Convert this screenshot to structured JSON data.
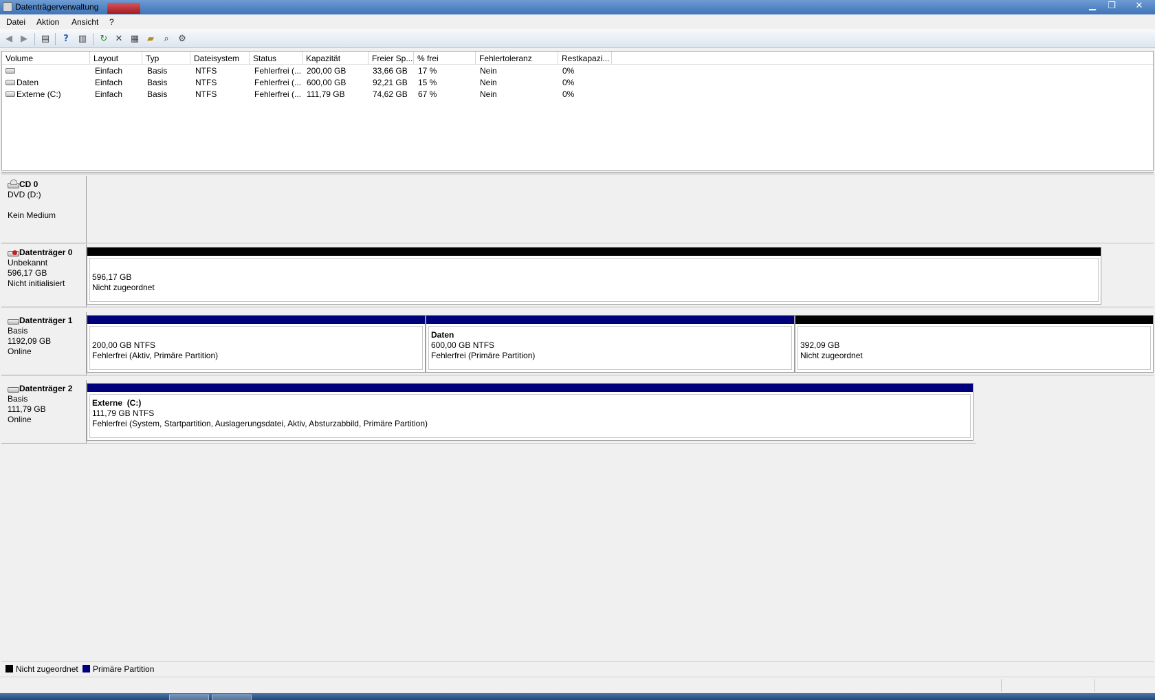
{
  "window": {
    "title": "Datenträgerverwaltung"
  },
  "menu": [
    "Datei",
    "Aktion",
    "Ansicht",
    "?"
  ],
  "toolbar_icons": [
    "back-arrow-icon",
    "forward-arrow-icon",
    "console-tree-icon",
    "help-icon",
    "show-pane-icon",
    "refresh-icon",
    "delete-icon",
    "properties-icon",
    "open-icon",
    "search-icon",
    "settings-icon"
  ],
  "volume_table": {
    "headers": [
      "Volume",
      "Layout",
      "Typ",
      "Dateisystem",
      "Status",
      "Kapazität",
      "Freier Sp...",
      "% frei",
      "Fehlertoleranz",
      "Restkapazi..."
    ],
    "rows": [
      {
        "volume": "",
        "layout": "Einfach",
        "typ": "Basis",
        "dateisystem": "NTFS",
        "status": "Fehlerfrei (...",
        "kapazitaet": "200,00 GB",
        "frei": "33,66 GB",
        "prozent": "17 %",
        "fehlertoleranz": "Nein",
        "rest": "0%"
      },
      {
        "volume": "Daten",
        "layout": "Einfach",
        "typ": "Basis",
        "dateisystem": "NTFS",
        "status": "Fehlerfrei (...",
        "kapazitaet": "600,00 GB",
        "frei": "92,21 GB",
        "prozent": "15 %",
        "fehlertoleranz": "Nein",
        "rest": "0%"
      },
      {
        "volume": "Externe (C:)",
        "layout": "Einfach",
        "typ": "Basis",
        "dateisystem": "NTFS",
        "status": "Fehlerfrei (...",
        "kapazitaet": "111,79 GB",
        "frei": "74,62 GB",
        "prozent": "67 %",
        "fehlertoleranz": "Nein",
        "rest": "0%"
      }
    ]
  },
  "disks": [
    {
      "name": "CD 0",
      "line1": "DVD (D:)",
      "line2": "",
      "line3": "Kein Medium"
    },
    {
      "name": "Datenträger 0",
      "line1": "Unbekannt",
      "line2": "596,17 GB",
      "line3": "Nicht initialisiert",
      "partitions": [
        {
          "title": "",
          "size": "596,17 GB",
          "status": "Nicht zugeordnet"
        }
      ]
    },
    {
      "name": "Datenträger 1",
      "line1": "Basis",
      "line2": "1192,09 GB",
      "line3": "Online",
      "partitions": [
        {
          "title": "",
          "size": "200,00 GB NTFS",
          "status": "Fehlerfrei (Aktiv, Primäre Partition)"
        },
        {
          "title": "Daten",
          "size": "600,00 GB NTFS",
          "status": "Fehlerfrei (Primäre Partition)"
        },
        {
          "title": "",
          "size": "392,09 GB",
          "status": "Nicht zugeordnet"
        }
      ]
    },
    {
      "name": "Datenträger 2",
      "line1": "Basis",
      "line2": "111,79 GB",
      "line3": "Online",
      "partitions": [
        {
          "title": "Externe  (C:)",
          "size": "111,79 GB NTFS",
          "status": "Fehlerfrei (System, Startpartition, Auslagerungsdatei, Aktiv, Absturzabbild, Primäre Partition)"
        }
      ]
    }
  ],
  "legend": [
    {
      "label": "Nicht zugeordnet",
      "color": "#000000"
    },
    {
      "label": "Primäre Partition",
      "color": "#00007c"
    }
  ],
  "colors": {
    "unallocated": "#000000",
    "primary_partition": "#00007c"
  }
}
